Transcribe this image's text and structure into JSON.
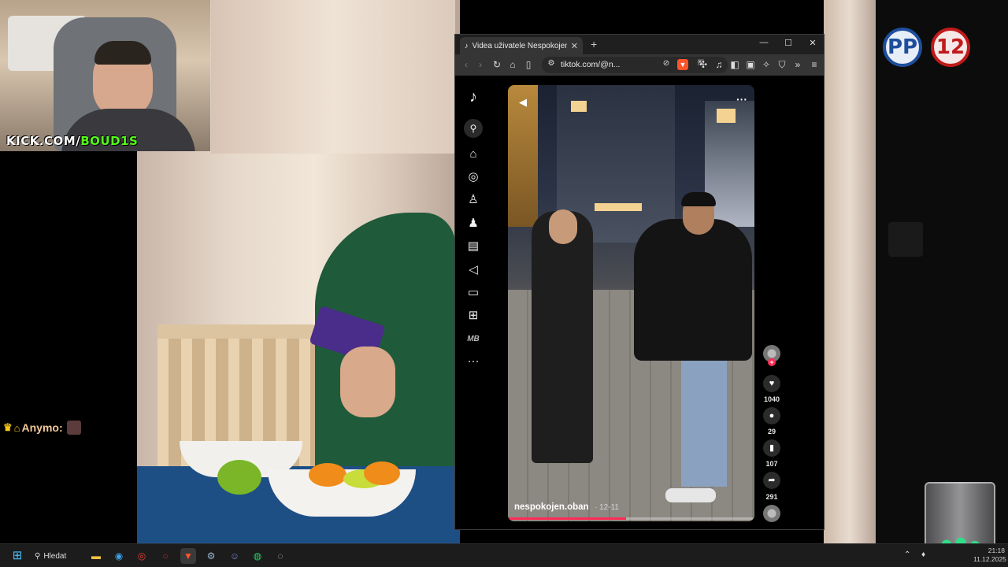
{
  "webcam": {
    "logo_prefix": "KICK.COM/",
    "logo_name": "BOUD1S"
  },
  "chat": {
    "username": "Anymo:"
  },
  "badges": {
    "left": "PP",
    "right": "12"
  },
  "browser": {
    "tab_title": "Videa uživatele Nespokojený Ob",
    "url": "tiktok.com/@n..."
  },
  "tiktok": {
    "sidebar_items": [
      "tiktok-logo",
      "search",
      "home",
      "explore",
      "following",
      "friends",
      "live",
      "messages",
      "activity",
      "upload",
      "mb",
      "more"
    ],
    "mb_label": "MB",
    "video": {
      "author": "nespokojen.oban",
      "date": "· 12-11",
      "progress": 0.48
    },
    "actions": {
      "likes": "1040",
      "comments": "29",
      "bookmarks": "107",
      "shares": "291"
    }
  },
  "taskbar": {
    "search_label": "Hledat",
    "time": "21:18",
    "date": "11.12.2025"
  },
  "colors": {
    "tiktok_red": "#fe2c55",
    "kick_green": "#53fc18",
    "brave_orange": "#fb542b",
    "taskbar_bg": "#1c1c1c"
  }
}
